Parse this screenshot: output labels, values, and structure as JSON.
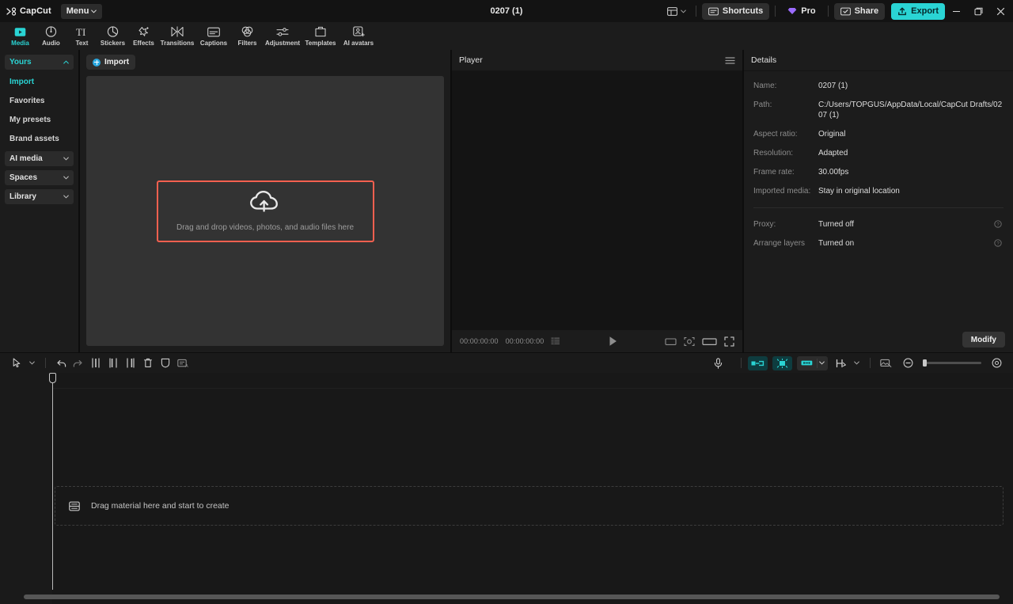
{
  "app": {
    "brand": "CapCut",
    "menu_label": "Menu",
    "project_title": "0207 (1)"
  },
  "titlebar": {
    "layout_icon": "layout-icon",
    "shortcuts_label": "Shortcuts",
    "pro_label": "Pro",
    "share_label": "Share",
    "export_label": "Export",
    "minimize": "minimize-icon",
    "maximize": "restore-icon",
    "close": "close-icon"
  },
  "navtabs": [
    {
      "label": "Media",
      "icon": "media-icon",
      "active": true
    },
    {
      "label": "Audio",
      "icon": "audio-icon",
      "active": false
    },
    {
      "label": "Text",
      "icon": "text-icon",
      "active": false
    },
    {
      "label": "Stickers",
      "icon": "stickers-icon",
      "active": false
    },
    {
      "label": "Effects",
      "icon": "effects-icon",
      "active": false
    },
    {
      "label": "Transitions",
      "icon": "transitions-icon",
      "active": false
    },
    {
      "label": "Captions",
      "icon": "captions-icon",
      "active": false
    },
    {
      "label": "Filters",
      "icon": "filters-icon",
      "active": false
    },
    {
      "label": "Adjustment",
      "icon": "adjustment-icon",
      "active": false
    },
    {
      "label": "Templates",
      "icon": "templates-icon",
      "active": false
    },
    {
      "label": "AI avatars",
      "icon": "ai-avatars-icon",
      "active": false
    }
  ],
  "sidebar": {
    "group_yours": "Yours",
    "items": [
      {
        "label": "Import",
        "active": true
      },
      {
        "label": "Favorites",
        "active": false
      },
      {
        "label": "My presets",
        "active": false
      },
      {
        "label": "Brand assets",
        "active": false
      }
    ],
    "groups": [
      {
        "label": "AI media"
      },
      {
        "label": "Spaces"
      },
      {
        "label": "Library"
      }
    ]
  },
  "media": {
    "import_label": "Import",
    "dropzone_text": "Drag and drop videos, photos, and audio files here",
    "dropzone_icon": "cloud-upload-icon"
  },
  "player": {
    "title": "Player",
    "menu_icon": "hamburger-icon",
    "current_time": "00:00:00:00",
    "total_time": "00:00:00:00",
    "list_icon": "timecode-list-icon",
    "play_icon": "play-icon",
    "controls": [
      "ratio-icon",
      "crop-icon",
      "widescreen-icon",
      "fullscreen-icon"
    ]
  },
  "details": {
    "title": "Details",
    "rows": [
      {
        "label": "Name:",
        "value": "0207 (1)",
        "help": false
      },
      {
        "label": "Path:",
        "value": "C:/Users/TOPGUS/AppData/Local/CapCut Drafts/0207 (1)",
        "help": false
      },
      {
        "label": "Aspect ratio:",
        "value": "Original",
        "help": false
      },
      {
        "label": "Resolution:",
        "value": "Adapted",
        "help": false
      },
      {
        "label": "Frame rate:",
        "value": "30.00fps",
        "help": false
      },
      {
        "label": "Imported media:",
        "value": "Stay in original location",
        "help": false
      }
    ],
    "rows2": [
      {
        "label": "Proxy:",
        "value": "Turned off",
        "help": true
      },
      {
        "label": "Arrange layers",
        "value": "Turned on",
        "help": true
      }
    ],
    "modify_label": "Modify"
  },
  "timeline": {
    "tools_left": [
      {
        "name": "select-tool",
        "icon": "cursor-icon"
      },
      {
        "name": "select-tool-dropdown",
        "icon": "chevron-down-icon"
      },
      {
        "name": "undo-button",
        "icon": "undo-icon"
      },
      {
        "name": "redo-button",
        "icon": "redo-icon"
      },
      {
        "name": "split-button",
        "icon": "split-icon"
      },
      {
        "name": "trim-left-button",
        "icon": "trim-left-icon"
      },
      {
        "name": "trim-right-button",
        "icon": "trim-right-icon"
      },
      {
        "name": "delete-button",
        "icon": "trash-icon"
      },
      {
        "name": "mirror-button",
        "icon": "shield-icon"
      },
      {
        "name": "auto-caption-button",
        "icon": "caption-box-icon"
      }
    ],
    "tools_right": [
      {
        "name": "record-voiceover-button",
        "icon": "microphone-icon"
      },
      {
        "name": "snap-left-button",
        "icon": "snap-left-icon"
      },
      {
        "name": "snap-center-button",
        "icon": "magnet-icon"
      },
      {
        "name": "snap-link-button",
        "icon": "link-icon"
      },
      {
        "name": "adjust-clip-button",
        "icon": "adjust-clip-icon"
      },
      {
        "name": "cover-button",
        "icon": "cover-icon"
      },
      {
        "name": "zoom-out-button",
        "icon": "zoom-out-icon"
      },
      {
        "name": "zoom-in-button",
        "icon": "zoom-in-icon"
      }
    ],
    "dropzone_text": "Drag material here and start to create",
    "dropzone_icon": "media-placeholder-icon",
    "zoom_value": 0
  },
  "colors": {
    "accent": "#2ad4d4",
    "highlight_border": "#f4604f",
    "panel_bg": "#1c1c1c",
    "window_bg": "#111111",
    "import_blue": "#2aa8e0"
  }
}
